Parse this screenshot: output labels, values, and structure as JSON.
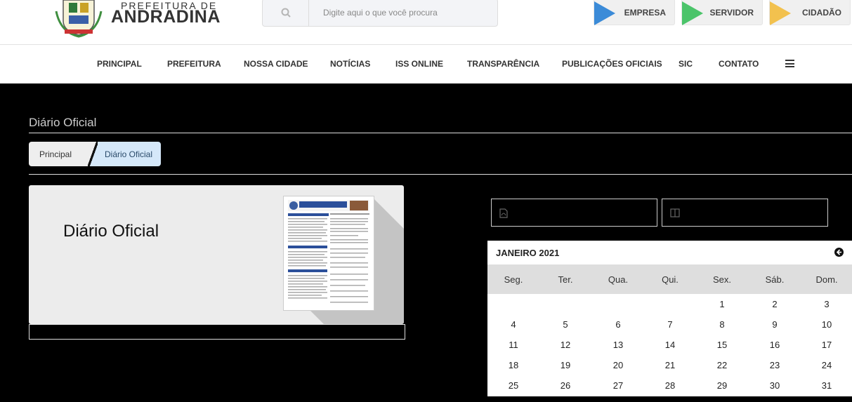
{
  "header": {
    "brand_line1": "PREFEITURA DE",
    "brand_line2": "ANDRADINA",
    "search_placeholder": "Digite aqui o que você procura",
    "portals": [
      "EMPRESA",
      "SERVIDOR",
      "CIDADÃO"
    ]
  },
  "nav": {
    "items": [
      "PRINCIPAL",
      "PREFEITURA",
      "NOSSA CIDADE",
      "NOTÍCIAS",
      "ISS ONLINE",
      "TRANSPARÊNCIA",
      "PUBLICAÇÕES OFICIAIS",
      "SIC",
      "CONTATO"
    ]
  },
  "main": {
    "page_title": "Diário Oficial",
    "breadcrumb": [
      "Principal",
      "Diário Oficial"
    ],
    "card_title": "Diário Oficial"
  },
  "calendar": {
    "month": "JANEIRO 2021",
    "weekdays": [
      "Seg.",
      "Ter.",
      "Qua.",
      "Qui.",
      "Sex.",
      "Sáb.",
      "Dom."
    ],
    "weeks": [
      [
        "",
        "",
        "",
        "",
        "1",
        "2",
        "3"
      ],
      [
        "4",
        "5",
        "6",
        "7",
        "8",
        "9",
        "10"
      ],
      [
        "11",
        "12",
        "13",
        "14",
        "15",
        "16",
        "17"
      ],
      [
        "18",
        "19",
        "20",
        "21",
        "22",
        "23",
        "24"
      ],
      [
        "25",
        "26",
        "27",
        "28",
        "29",
        "30",
        "31"
      ]
    ]
  },
  "colors": {
    "empresa": "#3b8bd8",
    "servidor": "#4bc46a",
    "cidadao": "#f2c14e",
    "breadcrumb_active": "#d5e8f9"
  }
}
